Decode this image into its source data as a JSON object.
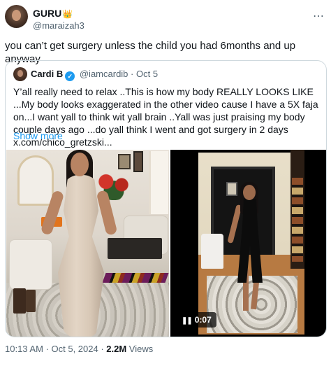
{
  "author": {
    "name": "GURU",
    "badge_emoji": "👑",
    "handle": "@maraizah3"
  },
  "more_icon": "⋯",
  "tweet_text": "you can’t get surgery unless the child you had 6months and up anyway",
  "quoted": {
    "name": "Cardi B",
    "verified_icon": "✓",
    "handle": "@iamcardib",
    "dot": "·",
    "date": "Oct 5",
    "text": "Y’all really need to relax ..This is how my body REALLY LOOKS LIKE ...My body looks exaggerated in the other video cause I have a 5X faja on...I want yall to think wit yall brain ..Yall was  just praising my body couple days ago ...do yall think I went and got surgery in 2 days  x.com/chico_gretzski...",
    "show_more": "Show more",
    "video": {
      "pause_icon": "❚❚",
      "duration": "0:07"
    }
  },
  "footer": {
    "time": "10:13 AM",
    "sep1": " · ",
    "date": "Oct 5, 2024",
    "sep2": " · ",
    "views_count": "2.2M",
    "views_label": " Views"
  }
}
